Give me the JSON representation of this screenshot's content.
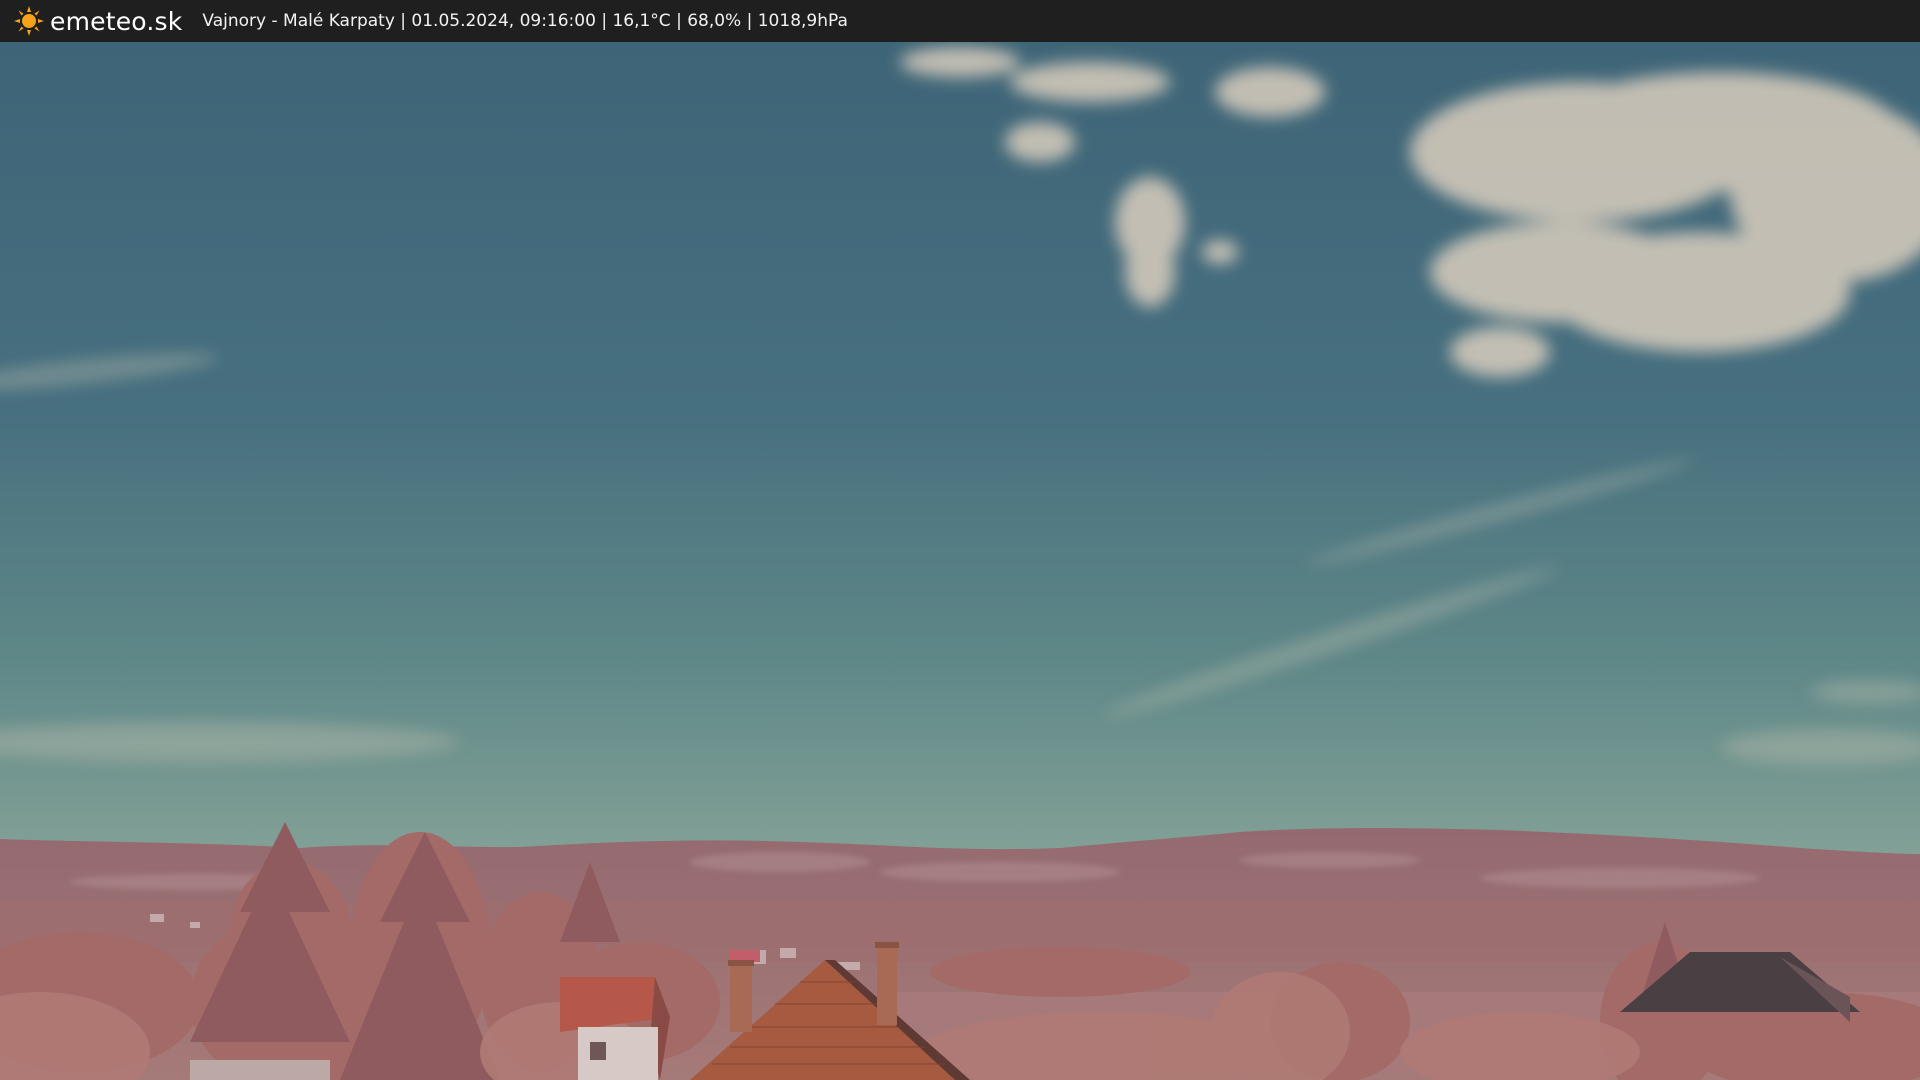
{
  "header": {
    "logo_icon": "sun-icon",
    "logo_text": "emeteo.sk",
    "caption": "Vajnory - Malé Karpaty | 01.05.2024, 09:16:00 | 16,1°C | 68,0% | 1018,9hPa"
  },
  "colors": {
    "bar_background": "#1f1f1f",
    "sun": "#f5a31a",
    "sky_top": "#3f6a7a",
    "sky_bottom": "#8fa9a0",
    "hills": "#9a6f72",
    "foliage": "#a8706c",
    "roof": "#b05a3a"
  }
}
